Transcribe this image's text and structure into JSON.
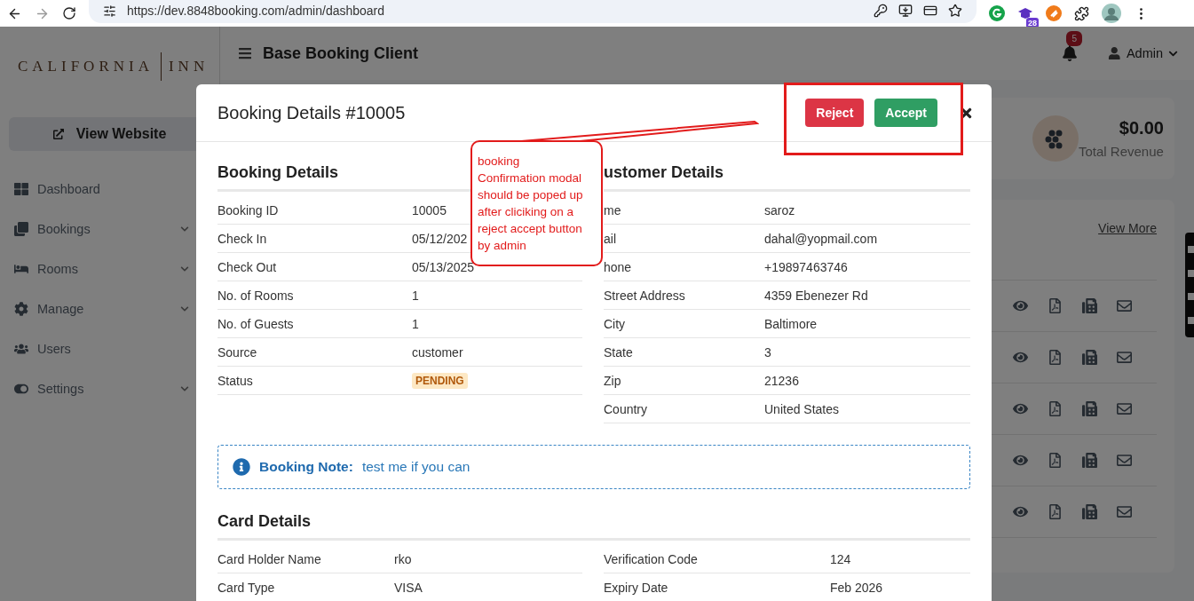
{
  "browser": {
    "url": "https://dev.8848booking.com/admin/dashboard",
    "extension_badge": "28"
  },
  "sidebar": {
    "logo": [
      "CALIFORNIA",
      "INN"
    ],
    "view_website": "View Website",
    "items": [
      {
        "label": "Dashboard",
        "has_submenu": false
      },
      {
        "label": "Bookings",
        "has_submenu": true
      },
      {
        "label": "Rooms",
        "has_submenu": true
      },
      {
        "label": "Manage",
        "has_submenu": true
      },
      {
        "label": "Users",
        "has_submenu": false
      },
      {
        "label": "Settings",
        "has_submenu": true
      }
    ]
  },
  "header": {
    "title": "Base Booking Client",
    "notifications": "5",
    "user": "Admin"
  },
  "dashboard": {
    "revenue": {
      "value": "$0.00",
      "label": "Total Revenue"
    },
    "bookings_card": {
      "link": "View More",
      "rows": [
        {
          "kind": "actions"
        },
        {
          "kind": "actions"
        },
        {
          "kind": "actions"
        },
        {
          "kind": "actions"
        },
        {
          "kind": "actions"
        }
      ]
    }
  },
  "modal": {
    "title": "Booking Details #10005",
    "buttons": [
      {
        "label": "Reject",
        "kind": "danger"
      },
      {
        "label": "Accept",
        "kind": "success"
      }
    ],
    "booking_details": {
      "title": "Booking Details",
      "rows": [
        {
          "label": "Booking ID",
          "value": "10005"
        },
        {
          "label": "Check In",
          "value": "05/12/202"
        },
        {
          "label": "Check Out",
          "value": "05/13/2025"
        },
        {
          "label": "No. of Rooms",
          "value": "1"
        },
        {
          "label": "No. of Guests",
          "value": "1"
        },
        {
          "label": "Source",
          "value": "customer"
        },
        {
          "label": "Status",
          "value": "PENDING",
          "kind": "badge"
        }
      ]
    },
    "customer_details": {
      "title": "ustomer Details",
      "rows": [
        {
          "label": "me",
          "value": "saroz"
        },
        {
          "label": "ail",
          "value": "dahal@yopmail.com"
        },
        {
          "label": "hone",
          "value": "+19897463746"
        },
        {
          "label": "Street Address",
          "value": "4359 Ebenezer Rd"
        },
        {
          "label": "City",
          "value": "Baltimore"
        },
        {
          "label": "State",
          "value": "3"
        },
        {
          "label": "Zip",
          "value": "21236"
        },
        {
          "label": "Country",
          "value": "United States"
        }
      ]
    },
    "note": {
      "label": "Booking Note:",
      "text": "test me if you can"
    },
    "card_details": {
      "title": "Card Details",
      "rows": [
        [
          {
            "label": "Card Holder Name",
            "value": "rko"
          },
          {
            "label": "Verification Code",
            "value": "124"
          }
        ],
        [
          {
            "label": "Card Type",
            "value": "VISA"
          },
          {
            "label": "Expiry Date",
            "value": "Feb 2026"
          }
        ]
      ]
    }
  },
  "annotation": {
    "callout": "booking Confirmation modal should be poped up after cliciking on a reject accept button by admin",
    "highlight_buttons": true
  }
}
